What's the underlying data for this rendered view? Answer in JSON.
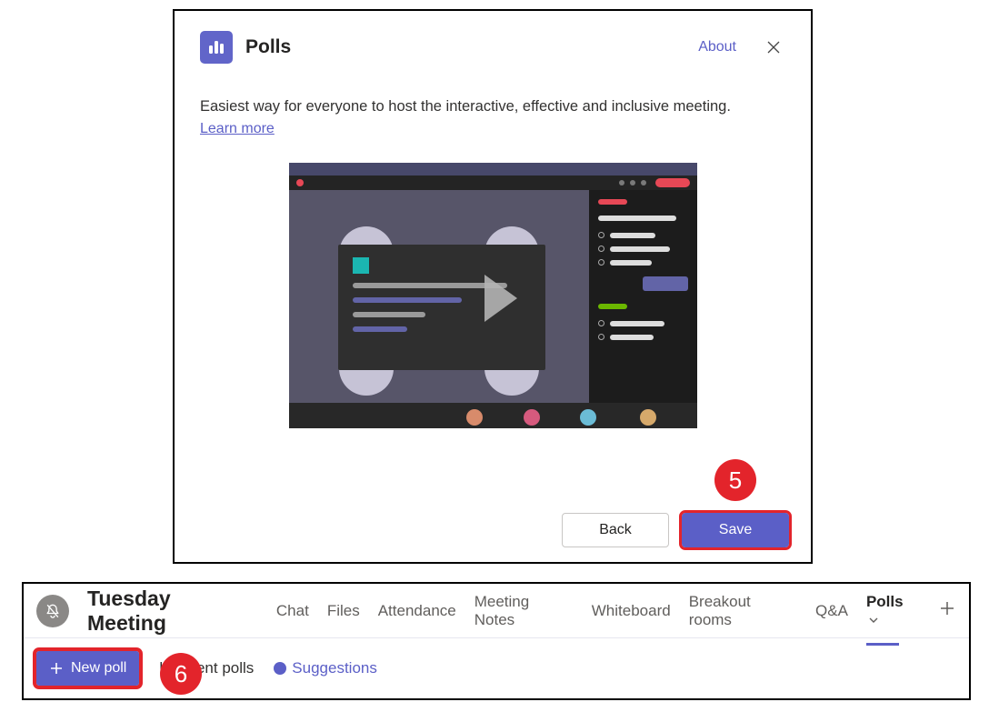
{
  "dialog": {
    "title": "Polls",
    "about": "About",
    "description": "Easiest way for everyone to host the interactive, effective and inclusive meeting.",
    "learn_more": "Learn more",
    "back_label": "Back",
    "save_label": "Save"
  },
  "callouts": {
    "step5": "5",
    "step6": "6"
  },
  "meeting": {
    "title": "Tuesday Meeting",
    "tabs": {
      "chat": "Chat",
      "files": "Files",
      "attendance": "Attendance",
      "notes": "Meeting Notes",
      "whiteboard": "Whiteboard",
      "breakout": "Breakout rooms",
      "qa": "Q&A",
      "polls": "Polls"
    },
    "sub": {
      "new_poll": "New poll",
      "recent": "ly recent polls",
      "suggestions": "Suggestions"
    }
  }
}
